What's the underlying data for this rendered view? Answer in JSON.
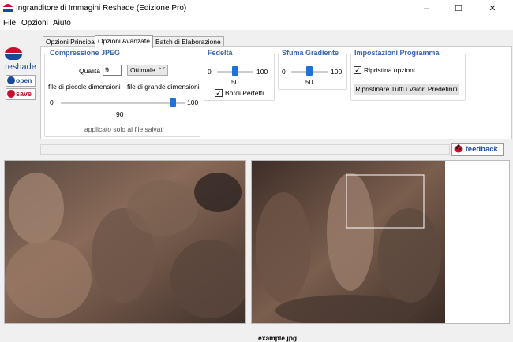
{
  "window": {
    "title": "Ingranditore di Immagini Reshade (Edizione Pro)",
    "minimize": "–",
    "maximize": "☐",
    "close": "✕"
  },
  "menu": [
    "File",
    "Opzioni",
    "Aiuto"
  ],
  "sidebar": {
    "logo_text": "reshade",
    "open_label": "open",
    "save_label": "save"
  },
  "tabs": [
    "Opzioni Principali",
    "Opzioni Avanzate",
    "Batch di Elaborazione"
  ],
  "active_tab": 1,
  "jpeg": {
    "title": "Compressione JPEG",
    "quality_label": "Qualità",
    "quality_value": "9",
    "preset_value": "Ottimale",
    "small_files_label": "file di piccole dimensioni",
    "large_files_label": "file di grande dimensioni",
    "slider_min": "0",
    "slider_max": "100",
    "slider_value": "90",
    "slider_fraction": 0.9,
    "note": "applicato solo ai file salvati"
  },
  "fidelity": {
    "title": "Fedeltà",
    "min": "0",
    "max": "100",
    "value": "50",
    "fraction": 0.5,
    "perfect_edges_label": "Bordi Perfetti",
    "perfect_edges_checked": true
  },
  "gradient": {
    "title": "Sfuma Gradiente",
    "min": "0",
    "max": "100",
    "value": "50",
    "fraction": 0.5
  },
  "program": {
    "title": "Impostazioni Programma",
    "restore_options_label": "Ripristina opzioni",
    "restore_options_checked": true,
    "reset_button": "Ripristinare Tutti i Valori Predefiniti"
  },
  "feedback_label": "feedback",
  "status": {
    "filename": "example.jpg"
  },
  "colors": {
    "accent": "#1f73d6",
    "group_title": "#3a63b0",
    "brand_red": "#b7102b",
    "brand_blue": "#1a4aa0"
  }
}
